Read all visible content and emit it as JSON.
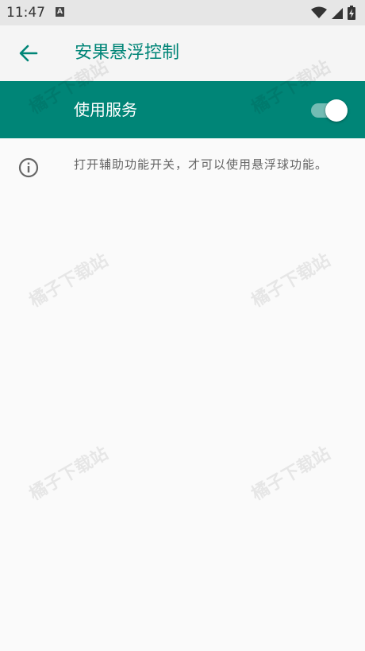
{
  "status_bar": {
    "time": "11:47",
    "keyboard_badge": "A"
  },
  "app_bar": {
    "title": "安果悬浮控制"
  },
  "service": {
    "label": "使用服务",
    "enabled": true
  },
  "info": {
    "text": "打开辅助功能开关，才可以使用悬浮球功能。"
  },
  "watermark": {
    "text": "橘子下载站"
  },
  "colors": {
    "primary": "#008577",
    "background": "#fafafa",
    "status_bar": "#e6e6e6"
  }
}
